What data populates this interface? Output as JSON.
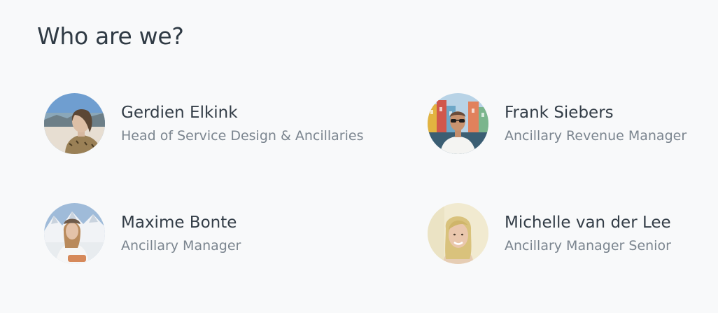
{
  "section": {
    "title": "Who are we?"
  },
  "team": [
    {
      "name": "Gerdien Elkink",
      "role": "Head of Service Design & Ancillaries",
      "avatar_icon": "photo-portrait-icon"
    },
    {
      "name": "Frank Siebers",
      "role": "Ancillary Revenue Manager",
      "avatar_icon": "photo-portrait-icon"
    },
    {
      "name": "Maxime Bonte",
      "role": "Ancillary Manager",
      "avatar_icon": "photo-portrait-icon"
    },
    {
      "name": "Michelle van der Lee",
      "role": "Ancillary Manager Senior",
      "avatar_icon": "photo-portrait-icon"
    }
  ],
  "colors": {
    "background": "#f8f9fa",
    "title": "#2f3a44",
    "name": "#333d47",
    "role": "#7b858f"
  }
}
